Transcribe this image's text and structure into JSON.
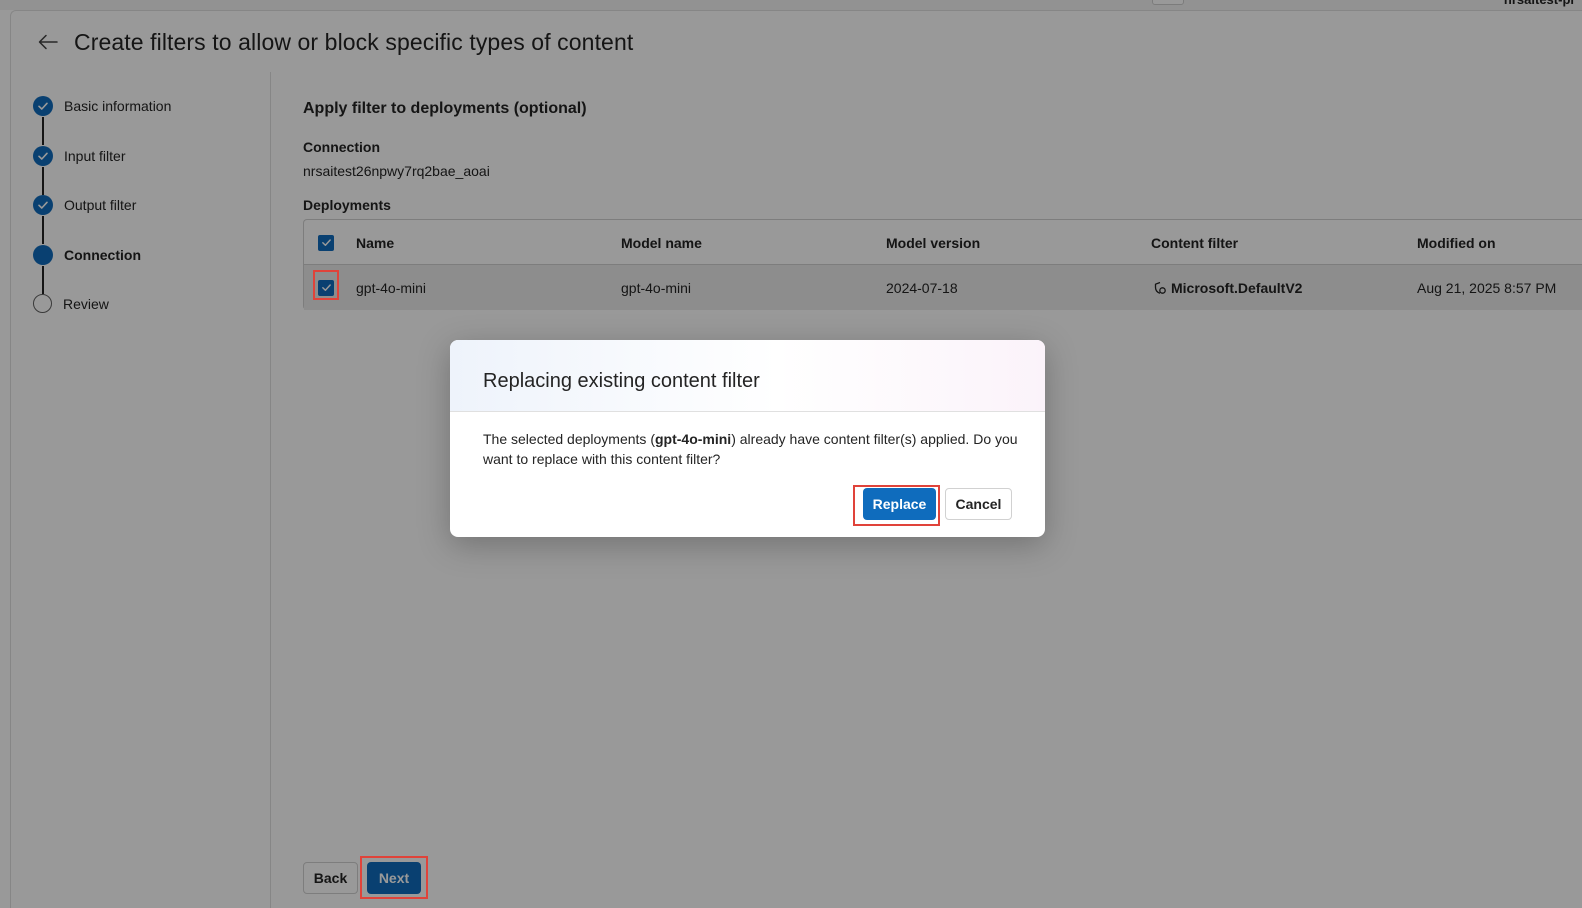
{
  "topbar": {
    "account_text": "nrsaitest-pi"
  },
  "page": {
    "title": "Create filters to allow or block specific types of content"
  },
  "steps": [
    {
      "label": "Basic information",
      "state": "done"
    },
    {
      "label": "Input filter",
      "state": "done"
    },
    {
      "label": "Output filter",
      "state": "done"
    },
    {
      "label": "Connection",
      "state": "current"
    },
    {
      "label": "Review",
      "state": "todo"
    }
  ],
  "main": {
    "section_title": "Apply filter to deployments (optional)",
    "connection_label": "Connection",
    "connection_value": "nrsaitest26npwy7rq2bae_aoai",
    "deployments_label": "Deployments"
  },
  "table": {
    "columns": [
      "Name",
      "Model name",
      "Model version",
      "Content filter",
      "Modified on"
    ],
    "rows": [
      {
        "name": "gpt-4o-mini",
        "model_name": "gpt-4o-mini",
        "model_version": "2024-07-18",
        "content_filter": "Microsoft.DefaultV2",
        "modified_on": "Aug 21, 2025 8:57 PM",
        "selected": true
      }
    ]
  },
  "footer": {
    "back_label": "Back",
    "next_label": "Next"
  },
  "dialog": {
    "title": "Replacing existing content filter",
    "body_prefix": "The selected deployments (",
    "body_bold": "gpt-4o-mini",
    "body_suffix": ") already have content filter(s) applied. Do you want to replace with this content filter?",
    "replace_label": "Replace",
    "cancel_label": "Cancel"
  },
  "colors": {
    "accent": "#0f6cbd",
    "highlight": "#e0433a"
  }
}
